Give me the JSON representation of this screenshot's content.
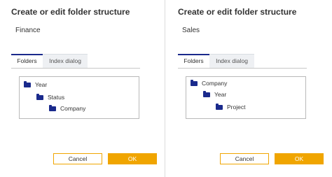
{
  "colors": {
    "accent": "#f0a500",
    "folder": "#1a2a8c",
    "active_tab_border": "#1a2a8c"
  },
  "dialogs": [
    {
      "title": "Create or edit folder structure",
      "name": "Finance",
      "tabs": [
        {
          "label": "Folders",
          "active": true
        },
        {
          "label": "Index dialog",
          "active": false
        }
      ],
      "tree": [
        {
          "label": "Year",
          "icon": "folder-icon",
          "level": 0
        },
        {
          "label": "Status",
          "icon": "folder-icon",
          "level": 1
        },
        {
          "label": "Company",
          "icon": "folder-icon",
          "level": 2
        }
      ],
      "buttons": {
        "cancel": "Cancel",
        "ok": "OK"
      }
    },
    {
      "title": "Create or edit folder structure",
      "name": "Sales",
      "tabs": [
        {
          "label": "Folders",
          "active": true
        },
        {
          "label": "Index dialog",
          "active": false
        }
      ],
      "tree": [
        {
          "label": "Company",
          "icon": "folder-icon",
          "level": 0
        },
        {
          "label": "Year",
          "icon": "folder-icon",
          "level": 1
        },
        {
          "label": "Project",
          "icon": "folder-icon",
          "level": 2
        }
      ],
      "buttons": {
        "cancel": "Cancel",
        "ok": "OK"
      }
    }
  ]
}
